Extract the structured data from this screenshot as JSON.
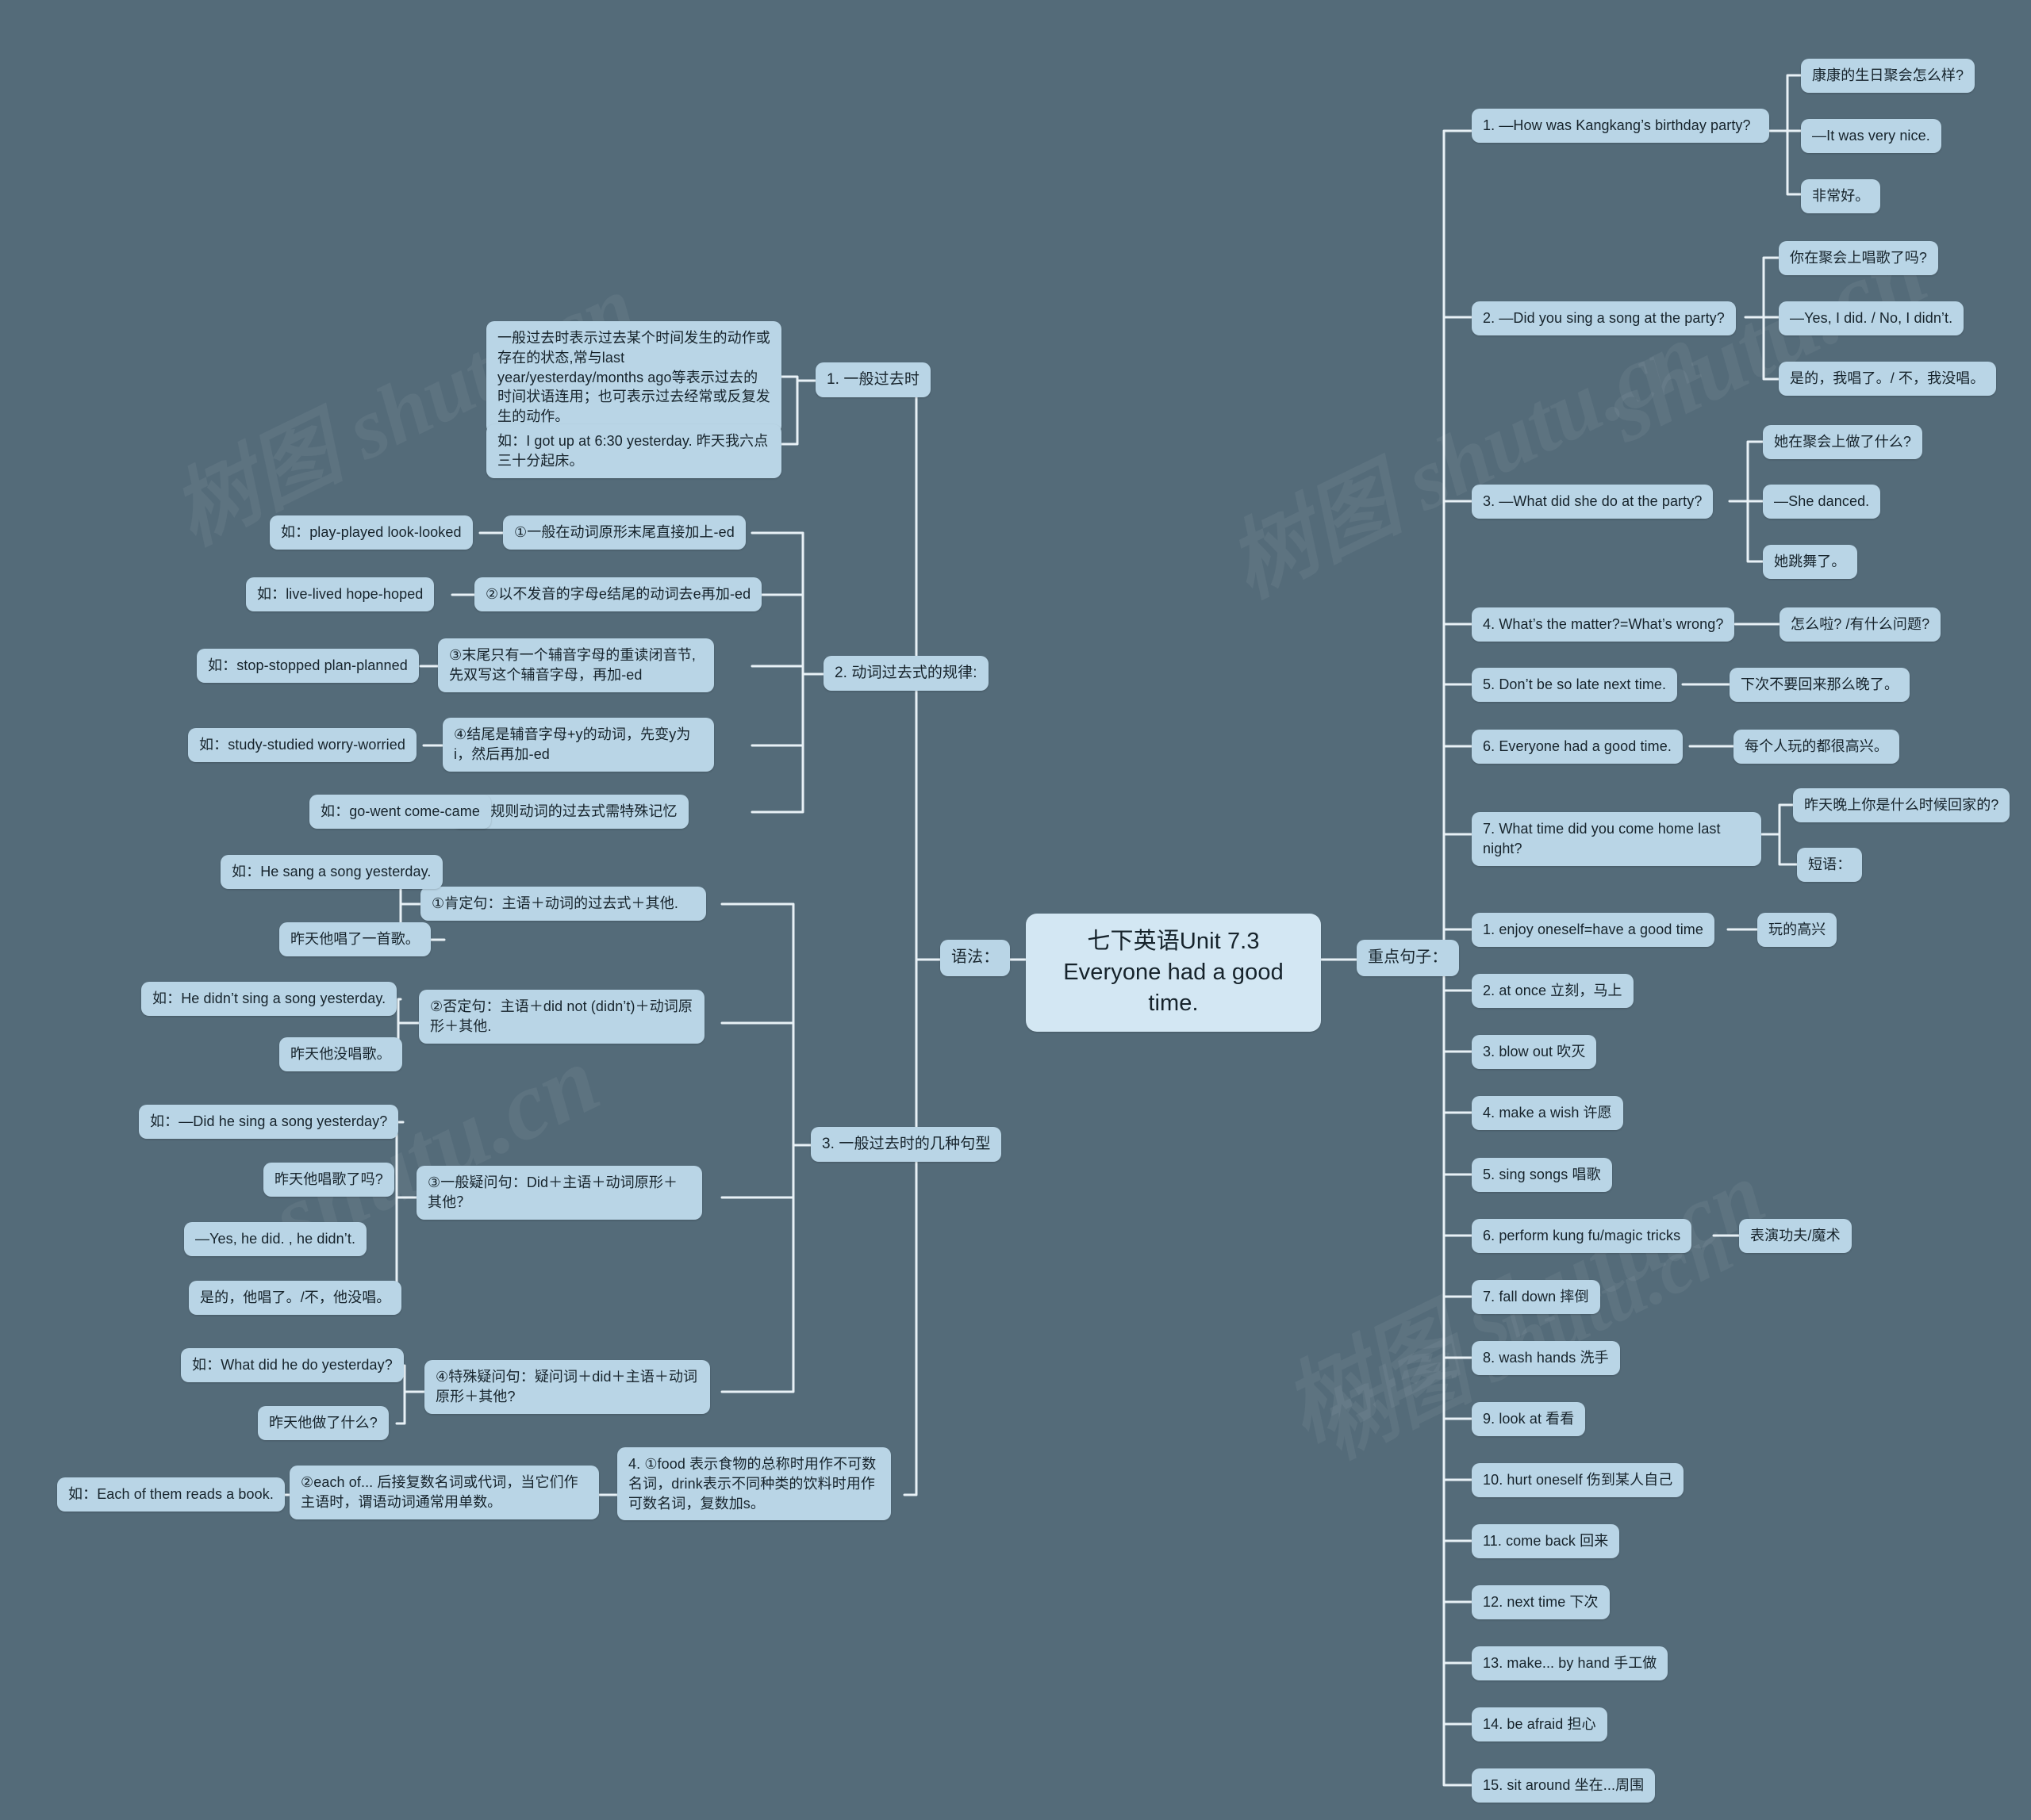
{
  "meta": {
    "background_color": "#546b79",
    "node_color": "#b9d5e6",
    "center_node_color": "#d3e7f3",
    "link_color": "#e8f1f6",
    "text_color": "#16232b"
  },
  "watermarks": [
    "树图 shutu.cn",
    "树图 shutu.cn",
    "shutu.cn",
    "树图 shutu.cn",
    "shutu.cn",
    "树图 shutu.cn"
  ],
  "center": {
    "title": "七下英语Unit 7.3 Everyone had a good time."
  },
  "branches": {
    "grammar": {
      "label": "语法："
    },
    "key_sentences": {
      "label": "重点句子："
    }
  },
  "grammar": {
    "topics": [
      {
        "label": "1. 一般过去时"
      },
      {
        "label": "2. 动词过去式的规律:"
      },
      {
        "label": "3. 一般过去时的几种句型"
      },
      {
        "label": "4. ①food 表示食物的总称时用作不可数名词，drink表示不同种类的饮料时用作可数名词，复数加s。"
      }
    ],
    "simple_past": [
      {
        "text": "一般过去时表示过去某个时间发生的动作或存在的状态,常与last year/yesterday/months ago等表示过去的时间状语连用；也可表示过去经常或反复发生的动作。"
      },
      {
        "text": "如：I got up at 6:30 yesterday. 昨天我六点三十分起床。"
      }
    ],
    "past_tense_rules": [
      {
        "rule": "①一般在动词原形末尾直接加上-ed",
        "example": "如：play-played  look-looked"
      },
      {
        "rule": "②以不发音的字母e结尾的动词去e再加-ed",
        "example": "如：live-lived  hope-hoped"
      },
      {
        "rule": "③末尾只有一个辅音字母的重读闭音节, 先双写这个辅音字母，再加-ed",
        "example": "如：stop-stopped plan-planned"
      },
      {
        "rule": "④结尾是辅音字母+y的动词，先变y为i，然后再加-ed",
        "example": "如：study-studied worry-worried"
      },
      {
        "rule": "⑤不规则动词的过去式需特殊记忆",
        "example": "如：go-went come-came"
      }
    ],
    "sentence_patterns": [
      {
        "pattern": "①肯定句：主语＋动词的过去式＋其他.",
        "examples": [
          "如：He sang a song yesterday.",
          "昨天他唱了一首歌。"
        ]
      },
      {
        "pattern": "②否定句：主语＋did not (didn’t)＋动词原形＋其他.",
        "examples": [
          "如：He didn’t sing a song yesterday.",
          "昨天他没唱歌。"
        ]
      },
      {
        "pattern": "③一般疑问句：Did＋主语＋动词原形＋其他？",
        "examples": [
          "如：—Did he sing a song yesterday?",
          "昨天他唱歌了吗?",
          "—Yes, he did. , he didn’t.",
          "是的，他唱了。/不，他没唱。"
        ]
      },
      {
        "pattern": "④特殊疑问句：疑问词＋did＋主语＋动词原形＋其他?",
        "examples": [
          "如：What did he do yesterday?",
          "昨天他做了什么?"
        ]
      }
    ],
    "each_of": {
      "rule": "②each of... 后接复数名词或代词，当它们作主语时，谓语动词通常用单数。",
      "example": "如：Each of them reads a book."
    }
  },
  "key_sentences": {
    "sentences": [
      {
        "text": "1. —How was Kangkang’s birthday party?",
        "children": [
          "康康的生日聚会怎么样?",
          "—It was very nice.",
          "非常好。"
        ]
      },
      {
        "text": "2. —Did you sing a song at the party?",
        "children": [
          "你在聚会上唱歌了吗?",
          "—Yes, I did. / No, I didn’t.",
          "是的，我唱了。/ 不，我没唱。"
        ]
      },
      {
        "text": "3. —What did she do at the party?",
        "children": [
          "她在聚会上做了什么?",
          "—She danced.",
          "她跳舞了。"
        ]
      },
      {
        "text": "4. What’s the matter?=What’s wrong?",
        "children": [
          "怎么啦? /有什么问题?"
        ]
      },
      {
        "text": "5. Don’t be so late next time.",
        "children": [
          "下次不要回来那么晚了。"
        ]
      },
      {
        "text": "6. Everyone had a good time.",
        "children": [
          "每个人玩的都很高兴。"
        ]
      },
      {
        "text": "7. What time did you come home last night?",
        "children": [
          "昨天晚上你是什么时候回家的?",
          "短语："
        ]
      }
    ],
    "phrases": [
      {
        "text": "1. enjoy oneself=have a good time",
        "children": [
          "玩的高兴"
        ]
      },
      {
        "text": "2. at once   立刻，马上",
        "children": []
      },
      {
        "text": "3. blow out  吹灭",
        "children": []
      },
      {
        "text": "4. make a wish  许愿",
        "children": []
      },
      {
        "text": "5. sing songs  唱歌",
        "children": []
      },
      {
        "text": "6. perform kung fu/magic tricks",
        "children": [
          "表演功夫/魔术"
        ]
      },
      {
        "text": "7. fall down  摔倒",
        "children": []
      },
      {
        "text": "8. wash hands  洗手",
        "children": []
      },
      {
        "text": "9. look at  看看",
        "children": []
      },
      {
        "text": "10. hurt oneself 伤到某人自己",
        "children": []
      },
      {
        "text": "11. come back  回来",
        "children": []
      },
      {
        "text": "12. next time   下次",
        "children": []
      },
      {
        "text": "13. make... by hand  手工做",
        "children": []
      },
      {
        "text": "14. be afraid  担心",
        "children": []
      },
      {
        "text": "15. sit around  坐在...周围",
        "children": []
      }
    ]
  }
}
